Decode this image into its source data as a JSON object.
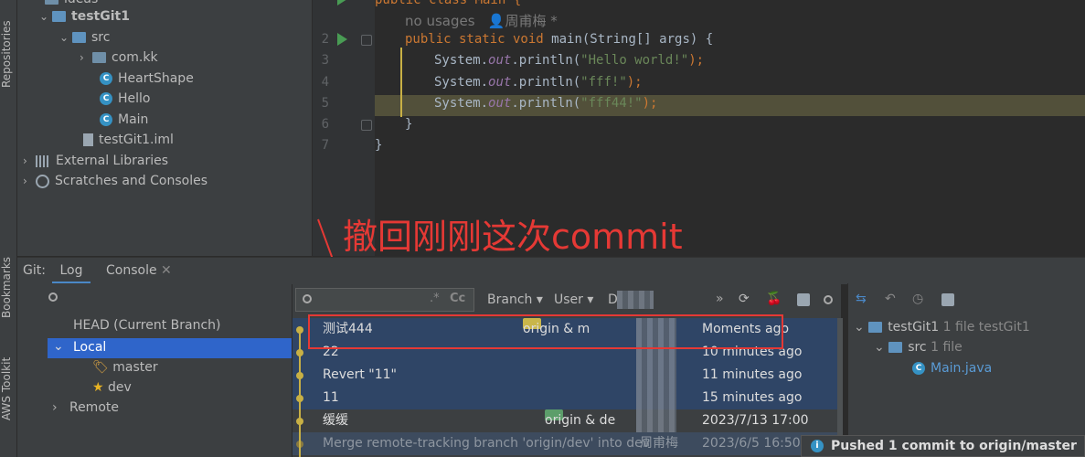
{
  "left_stripe": {
    "repositories": "Repositories",
    "bookmarks": "Bookmarks",
    "aws_toolkit": "AWS Toolkit"
  },
  "project_tree": {
    "items": [
      {
        "label": "ideas",
        "icon": "folder-icon"
      },
      {
        "label": "testGit1",
        "icon": "module-folder-icon"
      },
      {
        "label": "src",
        "icon": "source-folder-icon"
      },
      {
        "label": "com.kk",
        "icon": "package-icon"
      },
      {
        "label": "HeartShape",
        "icon": "class-icon"
      },
      {
        "label": "Hello",
        "icon": "class-icon"
      },
      {
        "label": "Main",
        "icon": "class-icon"
      },
      {
        "label": "testGit1.iml",
        "icon": "file-icon"
      },
      {
        "label": "External Libraries",
        "icon": "libraries-icon"
      },
      {
        "label": "Scratches and Consoles",
        "icon": "scratches-icon"
      }
    ]
  },
  "editor": {
    "line1_partial": "public class Main {",
    "no_usages": "no usages",
    "author": "周甫梅 *",
    "line_numbers": [
      "2",
      "3",
      "4",
      "5",
      "6",
      "7"
    ],
    "line2": {
      "kw": "public static void ",
      "rest": "main(String[] args) {"
    },
    "line3": {
      "a": "System.",
      "b": "out",
      "c": ".println(",
      "d": "\"Hello world!\"",
      "e": ");"
    },
    "line4": {
      "a": "System.",
      "b": "out",
      "c": ".println(",
      "d": "\"fff!\"",
      "e": ");"
    },
    "line5": {
      "a": "System.",
      "b": "out",
      "c": ".println(",
      "d": "\"fff44!\"",
      "e": ");"
    },
    "line6": "}",
    "line7": "}"
  },
  "annotation": "撤回刚刚这次commit",
  "bottom_tabs": {
    "git_label": "Git:",
    "log": "Log",
    "console": "Console"
  },
  "branches": {
    "head": "HEAD (Current Branch)",
    "local": "Local",
    "master": "master",
    "dev": "dev",
    "remote": "Remote"
  },
  "log_toolbar": {
    "branch": "Branch",
    "user": "User",
    "date_partial": "D",
    "regex": ".*",
    "case": "Cc"
  },
  "log_rows": [
    {
      "message": "测试444",
      "refs": "origin & m",
      "time": "Moments ago"
    },
    {
      "message": "22",
      "refs": "",
      "time": "10 minutes ago"
    },
    {
      "message": "Revert \"11\"",
      "refs": "",
      "time": "11 minutes ago"
    },
    {
      "message": "11",
      "refs": "",
      "time": "15 minutes ago"
    },
    {
      "message": "缓缓",
      "refs": "origin & de",
      "time": "2023/7/13 17:00"
    },
    {
      "message": "Merge remote-tracking branch 'origin/dev' into dev",
      "author": "周甫梅",
      "time": "2023/6/5 16:50"
    }
  ],
  "details": {
    "root": "testGit1",
    "root_meta": "1 file  testGit1",
    "src": "src",
    "src_meta": "1 file",
    "file": "Main.java"
  },
  "notification": "Pushed 1 commit to origin/master",
  "colors": {
    "accent_red": "#e53935",
    "selection": "#2f4566",
    "current_line": "#52503a"
  }
}
